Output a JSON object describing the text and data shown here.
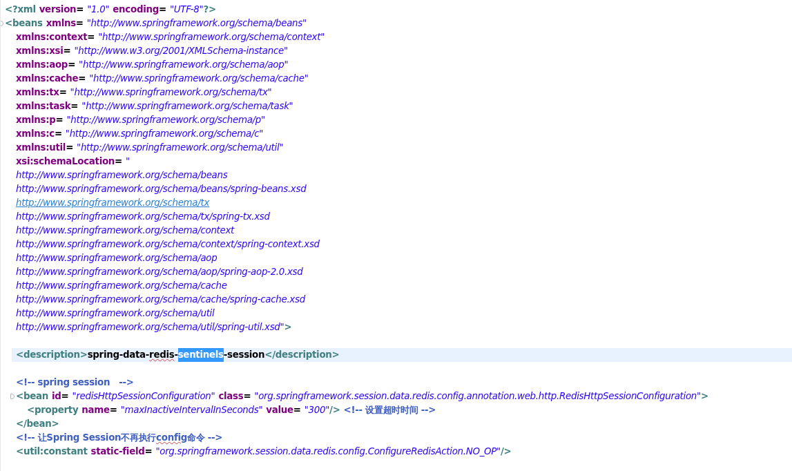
{
  "lines": [
    {
      "kind": "code",
      "tokens": [
        {
          "kind": "tag",
          "text": "<?xml"
        },
        {
          "kind": "attr",
          "text": "version"
        },
        {
          "kind": "eq",
          "text": "="
        },
        {
          "kind": "value",
          "text": "\"1.0\""
        },
        {
          "kind": "attr",
          "text": "encoding"
        },
        {
          "kind": "eq",
          "text": "="
        },
        {
          "kind": "value",
          "text": "\"UTF-8\""
        },
        {
          "kind": "tag",
          "text": "?>"
        }
      ]
    },
    {
      "kind": "code",
      "foldable": true,
      "tokens": [
        {
          "kind": "tag",
          "text": "<beans"
        },
        {
          "kind": "attr",
          "text": "xmlns"
        },
        {
          "kind": "eq",
          "text": "="
        },
        {
          "kind": "value",
          "text": "\"http://www.springframework.org/schema/beans\""
        }
      ],
      "children": [
        {
          "kind": "code",
          "tokens": [
            {
              "kind": "attr",
              "text": "xmlns:context"
            },
            {
              "kind": "eq",
              "text": "="
            },
            {
              "kind": "value",
              "text": "\"http://www.springframework.org/schema/context\""
            }
          ]
        },
        {
          "kind": "code",
          "tokens": [
            {
              "kind": "attr",
              "text": "xmlns:xsi"
            },
            {
              "kind": "eq",
              "text": "="
            },
            {
              "kind": "value",
              "text": "\"http://www.w3.org/2001/XMLSchema-instance\""
            }
          ]
        },
        {
          "kind": "code",
          "tokens": [
            {
              "kind": "attr",
              "text": "xmlns:aop"
            },
            {
              "kind": "eq",
              "text": "="
            },
            {
              "kind": "value",
              "text": "\"http://www.springframework.org/schema/aop\""
            }
          ]
        },
        {
          "kind": "code",
          "tokens": [
            {
              "kind": "attr",
              "text": "xmlns:cache"
            },
            {
              "kind": "eq",
              "text": "="
            },
            {
              "kind": "value",
              "text": "\"http://www.springframework.org/schema/cache\""
            }
          ]
        },
        {
          "kind": "code",
          "tokens": [
            {
              "kind": "attr",
              "text": "xmlns:tx"
            },
            {
              "kind": "eq",
              "text": "="
            },
            {
              "kind": "value",
              "text": "\"http://www.springframework.org/schema/tx\""
            }
          ]
        },
        {
          "kind": "code",
          "tokens": [
            {
              "kind": "attr",
              "text": "xmlns:task"
            },
            {
              "kind": "eq",
              "text": "="
            },
            {
              "kind": "value",
              "text": "\"http://www.springframework.org/schema/task\""
            }
          ]
        },
        {
          "kind": "code",
          "tokens": [
            {
              "kind": "attr",
              "text": "xmlns:p"
            },
            {
              "kind": "eq",
              "text": "="
            },
            {
              "kind": "value",
              "text": "\"http://www.springframework.org/schema/p\""
            }
          ]
        },
        {
          "kind": "code",
          "tokens": [
            {
              "kind": "attr",
              "text": "xmlns:c"
            },
            {
              "kind": "eq",
              "text": "="
            },
            {
              "kind": "value",
              "text": "\"http://www.springframework.org/schema/c\""
            }
          ]
        },
        {
          "kind": "code",
          "tokens": [
            {
              "kind": "attr",
              "text": "xmlns:util"
            },
            {
              "kind": "eq",
              "text": "="
            },
            {
              "kind": "value",
              "text": "\"http://www.springframework.org/schema/util\""
            }
          ]
        },
        {
          "kind": "code",
          "tokens": [
            {
              "kind": "attr",
              "text": "xsi:schemaLocation"
            },
            {
              "kind": "eq",
              "text": "="
            },
            {
              "kind": "value",
              "text": "\""
            }
          ]
        },
        {
          "kind": "code",
          "tokens": [
            {
              "kind": "value",
              "text": "http://www.springframework.org/schema/beans"
            }
          ]
        },
        {
          "kind": "code",
          "tokens": [
            {
              "kind": "value",
              "text": "http://www.springframework.org/schema/beans/spring-beans.xsd"
            }
          ]
        },
        {
          "kind": "code",
          "tokens": [
            {
              "kind": "link",
              "text": "http://www.springframework.org/schema/tx"
            }
          ]
        },
        {
          "kind": "code",
          "tokens": [
            {
              "kind": "value",
              "text": "http://www.springframework.org/schema/tx/spring-tx.xsd"
            }
          ]
        },
        {
          "kind": "code",
          "tokens": [
            {
              "kind": "value",
              "text": "http://www.springframework.org/schema/context"
            }
          ]
        },
        {
          "kind": "code",
          "tokens": [
            {
              "kind": "value",
              "text": "http://www.springframework.org/schema/context/spring-context.xsd"
            }
          ]
        },
        {
          "kind": "code",
          "tokens": [
            {
              "kind": "value",
              "text": "http://www.springframework.org/schema/aop"
            }
          ]
        },
        {
          "kind": "code",
          "tokens": [
            {
              "kind": "value",
              "text": "http://www.springframework.org/schema/aop/spring-aop-2.0.xsd"
            }
          ]
        },
        {
          "kind": "code",
          "tokens": [
            {
              "kind": "value",
              "text": "http://www.springframework.org/schema/cache"
            }
          ]
        },
        {
          "kind": "code",
          "tokens": [
            {
              "kind": "value",
              "text": "http://www.springframework.org/schema/cache/spring-cache.xsd"
            }
          ]
        },
        {
          "kind": "code",
          "tokens": [
            {
              "kind": "value",
              "text": "http://www.springframework.org/schema/util"
            }
          ]
        },
        {
          "kind": "code",
          "tokens": [
            {
              "kind": "value",
              "text": "http://www.springframework.org/schema/util/spring-util.xsd\""
            },
            {
              "kind": "tag",
              "text": ">"
            }
          ]
        },
        {
          "kind": "blank"
        },
        {
          "kind": "code",
          "current": true,
          "tokens": [
            {
              "kind": "tag",
              "text": "<description>"
            },
            {
              "kind": "text",
              "text": "spring-data-"
            },
            {
              "kind": "text",
              "text": "redis",
              "misspelled": true
            },
            {
              "kind": "text",
              "text": "-"
            },
            {
              "kind": "text",
              "text": "sentinels",
              "selected": true
            },
            {
              "kind": "text",
              "text": "-session"
            },
            {
              "kind": "tag",
              "text": "</description>"
            }
          ]
        },
        {
          "kind": "blank"
        },
        {
          "kind": "code",
          "tokens": [
            {
              "kind": "comment",
              "text": "<!-- spring session   -->"
            }
          ]
        },
        {
          "kind": "code",
          "foldable": true,
          "tokens": [
            {
              "kind": "tag",
              "text": "<bean"
            },
            {
              "kind": "attr",
              "text": "id"
            },
            {
              "kind": "eq",
              "text": "="
            },
            {
              "kind": "value",
              "text": "\"redisHttpSessionConfiguration\""
            },
            {
              "kind": "attr",
              "text": "class"
            },
            {
              "kind": "eq",
              "text": "="
            },
            {
              "kind": "value",
              "text": "\"org.springframework.session.data.redis.config.annotation.web.http.RedisHttpSessionConfiguration\""
            },
            {
              "kind": "tag",
              "text": ">"
            }
          ],
          "children": [
            {
              "kind": "code",
              "tokens": [
                {
                  "kind": "tag",
                  "text": "<property"
                },
                {
                  "kind": "attr",
                  "text": "name"
                },
                {
                  "kind": "eq",
                  "text": "="
                },
                {
                  "kind": "value",
                  "text": "\"maxInactiveIntervalInSeconds\""
                },
                {
                  "kind": "attr",
                  "text": "value"
                },
                {
                  "kind": "eq",
                  "text": "="
                },
                {
                  "kind": "value",
                  "text": "\"300\""
                },
                {
                  "kind": "tag",
                  "text": "/>"
                },
                {
                  "kind": "comment",
                  "text": "<!-- 设置超时时间 -->"
                }
              ]
            }
          ]
        },
        {
          "kind": "code",
          "tokens": [
            {
              "kind": "tag",
              "text": "</bean>"
            }
          ]
        },
        {
          "kind": "code",
          "tokens": [
            {
              "kind": "comment",
              "text": "<!-- 让Spring Session不再执行"
            },
            {
              "kind": "comment",
              "text": "config",
              "misspelled": true
            },
            {
              "kind": "comment",
              "text": "命令 -->"
            }
          ]
        },
        {
          "kind": "code",
          "tokens": [
            {
              "kind": "tag",
              "text": "<util:constant"
            },
            {
              "kind": "attr",
              "text": "static-field"
            },
            {
              "kind": "eq",
              "text": "="
            },
            {
              "kind": "value",
              "text": "\"org.springframework.session.data.redis.config.ConfigureRedisAction.NO_OP\""
            },
            {
              "kind": "tag",
              "text": "/>"
            }
          ]
        }
      ]
    }
  ]
}
